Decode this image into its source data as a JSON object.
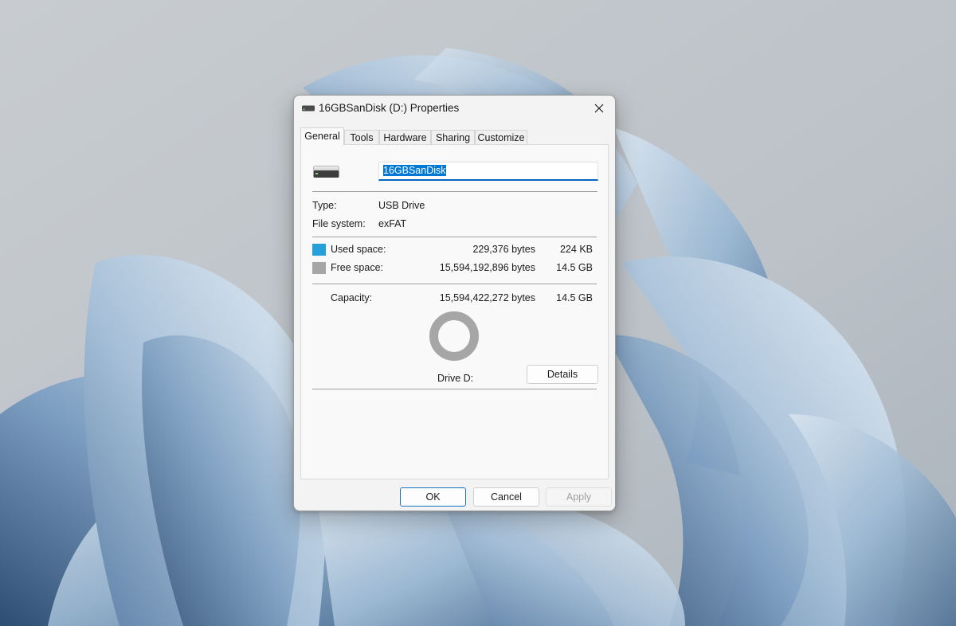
{
  "dialog": {
    "title": "16GBSanDisk (D:) Properties",
    "tabs": [
      {
        "label": "General",
        "active": true
      },
      {
        "label": "Tools"
      },
      {
        "label": "Hardware"
      },
      {
        "label": "Sharing"
      },
      {
        "label": "Customize"
      }
    ],
    "general": {
      "drive_name_value": "16GBSanDisk",
      "type_label": "Type:",
      "type_value": "USB Drive",
      "filesystem_label": "File system:",
      "filesystem_value": "exFAT",
      "used_label": "Used space:",
      "used_bytes": "229,376 bytes",
      "used_size": "224 KB",
      "free_label": "Free space:",
      "free_bytes": "15,594,192,896 bytes",
      "free_size": "14.5 GB",
      "capacity_label": "Capacity:",
      "capacity_bytes": "15,594,422,272 bytes",
      "capacity_size": "14.5 GB",
      "drive_label": "Drive D:",
      "details_button": "Details",
      "used_fraction": 1.47e-05
    },
    "buttons": {
      "ok": "OK",
      "cancel": "Cancel",
      "apply": "Apply"
    }
  },
  "colors": {
    "used_space": "#26a0da",
    "free_space": "#a6a6a6",
    "accent": "#0078d4"
  },
  "icons": {
    "title_icon": "usb-drive-icon",
    "drive_icon": "usb-drive-icon",
    "close_icon": "close-icon"
  }
}
